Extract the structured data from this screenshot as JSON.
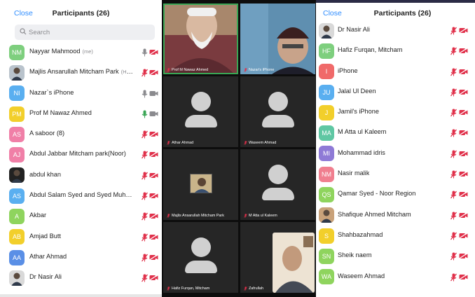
{
  "left": {
    "close": "Close",
    "title": "Participants (26)",
    "search_placeholder": "Search",
    "rows": [
      {
        "initials": "NM",
        "color": "#7ecf7e",
        "name": "Nayyar Mahmood",
        "tag": "(me)",
        "mic": "on-grey",
        "cam": "off"
      },
      {
        "initials": "",
        "color": "#b9c3cc",
        "name": "Majlis Ansarullah Mitcham Park",
        "tag": "(Host)",
        "mic": "off",
        "cam": "off",
        "photo": true
      },
      {
        "initials": "NI",
        "color": "#5aaff0",
        "name": "Nazar`s iPhone",
        "tag": "",
        "mic": "on-grey",
        "cam": "on-grey"
      },
      {
        "initials": "PM",
        "color": "#f2cf2b",
        "name": "Prof M Nawaz Ahmed",
        "tag": "",
        "mic": "on-green",
        "cam": "on-grey"
      },
      {
        "initials": "AS",
        "color": "#f07fa7",
        "name": "A saboor (8)",
        "tag": "",
        "mic": "off",
        "cam": "off"
      },
      {
        "initials": "AJ",
        "color": "#f07fa7",
        "name": "Abdul Jabbar Mitcham park(Noor)",
        "tag": "",
        "mic": "off",
        "cam": "off"
      },
      {
        "initials": "",
        "color": "#222222",
        "name": "abdul khan",
        "tag": "",
        "mic": "off",
        "cam": "off",
        "photo": true
      },
      {
        "initials": "AS",
        "color": "#5aaff0",
        "name": "Abdul Salam Syed and Syed Muha...",
        "tag": "",
        "mic": "off",
        "cam": "off"
      },
      {
        "initials": "A",
        "color": "#8fd45e",
        "name": "Akbar",
        "tag": "",
        "mic": "off",
        "cam": "off"
      },
      {
        "initials": "AB",
        "color": "#f2cf2b",
        "name": "Amjad Butt",
        "tag": "",
        "mic": "off",
        "cam": "off"
      },
      {
        "initials": "AA",
        "color": "#5a8fe6",
        "name": "Athar Ahmad",
        "tag": "",
        "mic": "off",
        "cam": "off"
      },
      {
        "initials": "",
        "color": "#d9d9d9",
        "name": "Dr Nasir Ali",
        "tag": "",
        "mic": "off",
        "cam": "off",
        "photo": true
      }
    ]
  },
  "grid": {
    "tiles": [
      {
        "label": "Prof M Nawaz Ahmed",
        "video": true,
        "active": true
      },
      {
        "label": "Nazar's iPhone",
        "video": true
      },
      {
        "label": "Athar Ahmad"
      },
      {
        "label": "Waseem Ahmad"
      },
      {
        "label": "Majlis Ansarullah Mitcham Park",
        "thumb": true
      },
      {
        "label": "M Atta ul Kaleem"
      },
      {
        "label": "Hafiz Furqan, Mitcham"
      },
      {
        "label": "Zafrullah",
        "video": true
      }
    ]
  },
  "right": {
    "close": "Close",
    "title": "Participants (26)",
    "rows": [
      {
        "initials": "",
        "color": "#d9d9d9",
        "name": "Dr Nasir Ali",
        "photo": true
      },
      {
        "initials": "HF",
        "color": "#7ecf7e",
        "name": "Hafiz Furqan, Mitcham"
      },
      {
        "initials": "I",
        "color": "#f06a6a",
        "name": "iPhone"
      },
      {
        "initials": "JU",
        "color": "#5aaff0",
        "name": "Jalal Ul Deen"
      },
      {
        "initials": "J",
        "color": "#f2cf2b",
        "name": "Jamil's iPhone"
      },
      {
        "initials": "MA",
        "color": "#5fc7a3",
        "name": "M Atta ul Kaleem"
      },
      {
        "initials": "MI",
        "color": "#8e7ad6",
        "name": "Mohammad idris"
      },
      {
        "initials": "NM",
        "color": "#f07f8f",
        "name": "Nasir malik"
      },
      {
        "initials": "QS",
        "color": "#8fd45e",
        "name": "Qamar Syed - Noor Region"
      },
      {
        "initials": "",
        "color": "#c9a27a",
        "name": "Shafique Ahmed Mitcham",
        "photo": true
      },
      {
        "initials": "S",
        "color": "#f2cf2b",
        "name": "Shahbazahmad"
      },
      {
        "initials": "SN",
        "color": "#8fd45e",
        "name": "Sheik naem"
      },
      {
        "initials": "WA",
        "color": "#8fd45e",
        "name": "Waseem Ahmad"
      }
    ]
  }
}
